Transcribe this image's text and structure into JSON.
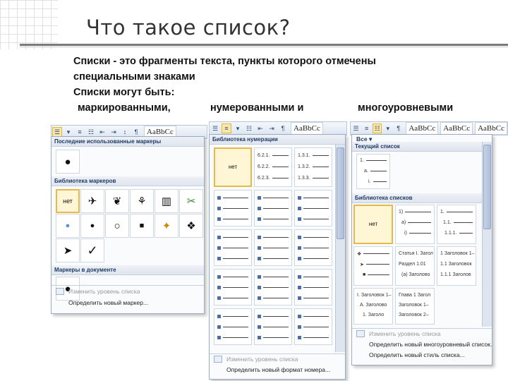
{
  "slide": {
    "title": "Что такое список?",
    "lines": [
      "Списки - это фрагменты текста, пункты которого отмечены",
      "специальными знаками",
      "Списки могут быть:"
    ],
    "kinds": [
      "маркированными,",
      "нумерованными и",
      "многоуровневыми"
    ]
  },
  "bullets_panel": {
    "style_label": "AaBbCc",
    "sections": {
      "recent": "Последние использованные маркеры",
      "library": "Библиотека маркеров",
      "document": "Маркеры в документе"
    },
    "recent_symbols": [
      "●"
    ],
    "library_symbols": [
      "нет",
      "✈",
      "❦",
      "⚘",
      "▥",
      "✂",
      "●",
      "●",
      "○",
      "■",
      "✦",
      "❖",
      "➤",
      "✓"
    ],
    "document_symbols": [
      "●"
    ],
    "menu": [
      "Изменить уровень списка",
      "Определить новый маркер..."
    ]
  },
  "numbering_panel": {
    "style_label": "AaBbCc",
    "section": "Библиотека нумерации",
    "none_label": "нет",
    "preview_a": [
      "6.2.1.",
      "6.2.2.",
      "6.2.3."
    ],
    "preview_b": [
      "1.3.1.",
      "1.3.2.",
      "1.3.3."
    ],
    "menu": [
      "Изменить уровень списка",
      "Определить новый формат номера..."
    ]
  },
  "multilevel_panel": {
    "style_labels": [
      "AaBbCc",
      "AaBbCc",
      "AaBbCc"
    ],
    "top": "Все ▾",
    "current_section": "Текущий список",
    "current_preview": [
      "1.",
      "a.",
      "i."
    ],
    "library_section": "Библиотека списков",
    "none_label": "нет",
    "preview_num": [
      "1)",
      "a)",
      "i)"
    ],
    "preview_dec": [
      "1.",
      "1.1.",
      "1.1.1."
    ],
    "preview_article": [
      "Статья I. Загол",
      "Раздел 1.01",
      "(a) Заголово"
    ],
    "preview_heading": [
      "1 Заголовок 1–",
      "1.1 Заголовок",
      "1.1.1 Заголов"
    ],
    "preview_roman": [
      "I. Заголовок 1–",
      "A. Заголово",
      "1. Заголо"
    ],
    "preview_chapter": [
      "Глава 1 Загол",
      "Заголовок 1–",
      "Заголовок 2–"
    ],
    "menu": [
      "Изменить уровень списка",
      "Определить новый многоуровневый список...",
      "Определить новый стиль списка..."
    ]
  }
}
